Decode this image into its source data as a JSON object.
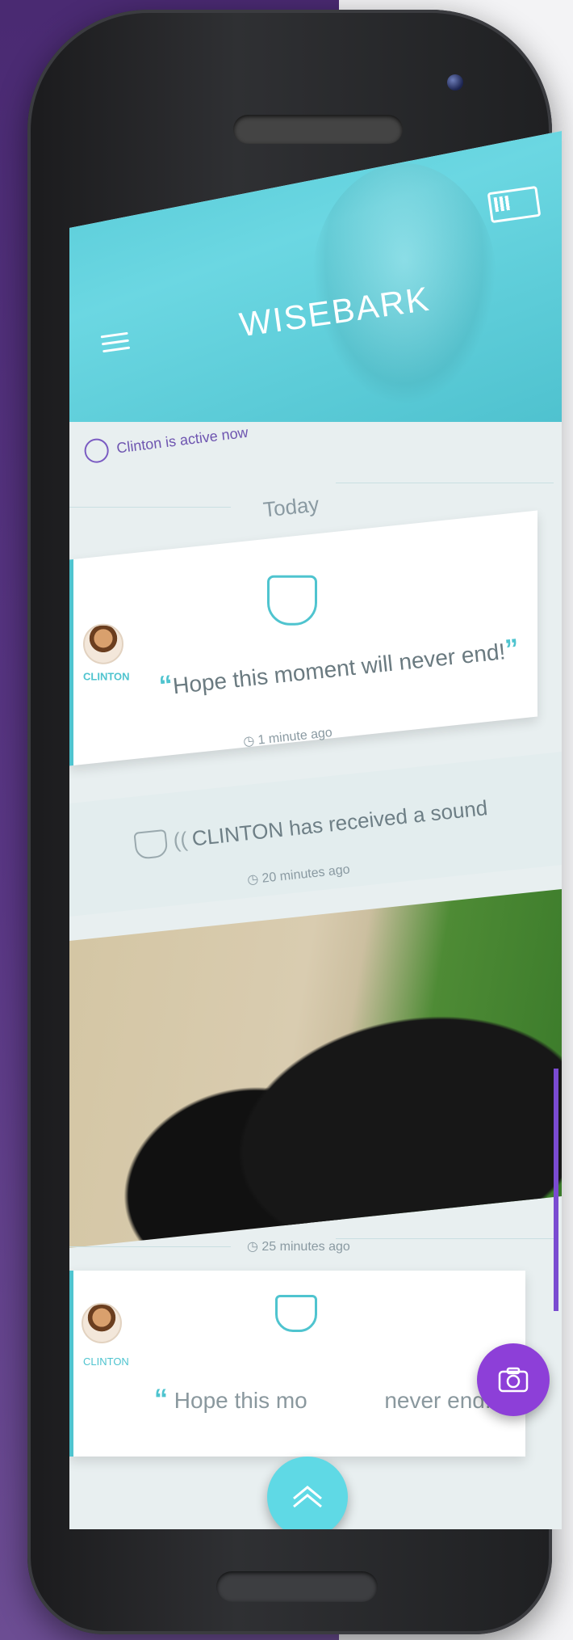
{
  "app": {
    "title": "WISEBARK"
  },
  "status": {
    "text": "Clinton is active now"
  },
  "feed": {
    "day_label": "Today",
    "message1": {
      "author": "CLINTON",
      "open_quote": "“",
      "text": "Hope this moment will never end!",
      "close_quote": "”",
      "time": "1 minute ago"
    },
    "sound_event": {
      "text": "CLINTON has received a sound",
      "time": "20 minutes ago"
    },
    "photo_event": {
      "time": "25 minutes ago"
    },
    "message2": {
      "author": "CLINTON",
      "open_quote": "“",
      "text_start": "Hope this mo",
      "text_end": "never end!",
      "close_quote": "”"
    }
  },
  "icons": [
    "menu-icon",
    "battery-icon",
    "dog-face-icon",
    "clock-icon",
    "sound-wave-icon",
    "camera-icon",
    "chevron-up-icon"
  ],
  "colors": {
    "accent_teal": "#4fc4cf",
    "fab_purple": "#8d3fd8",
    "background_purple": "#4a2a72"
  }
}
